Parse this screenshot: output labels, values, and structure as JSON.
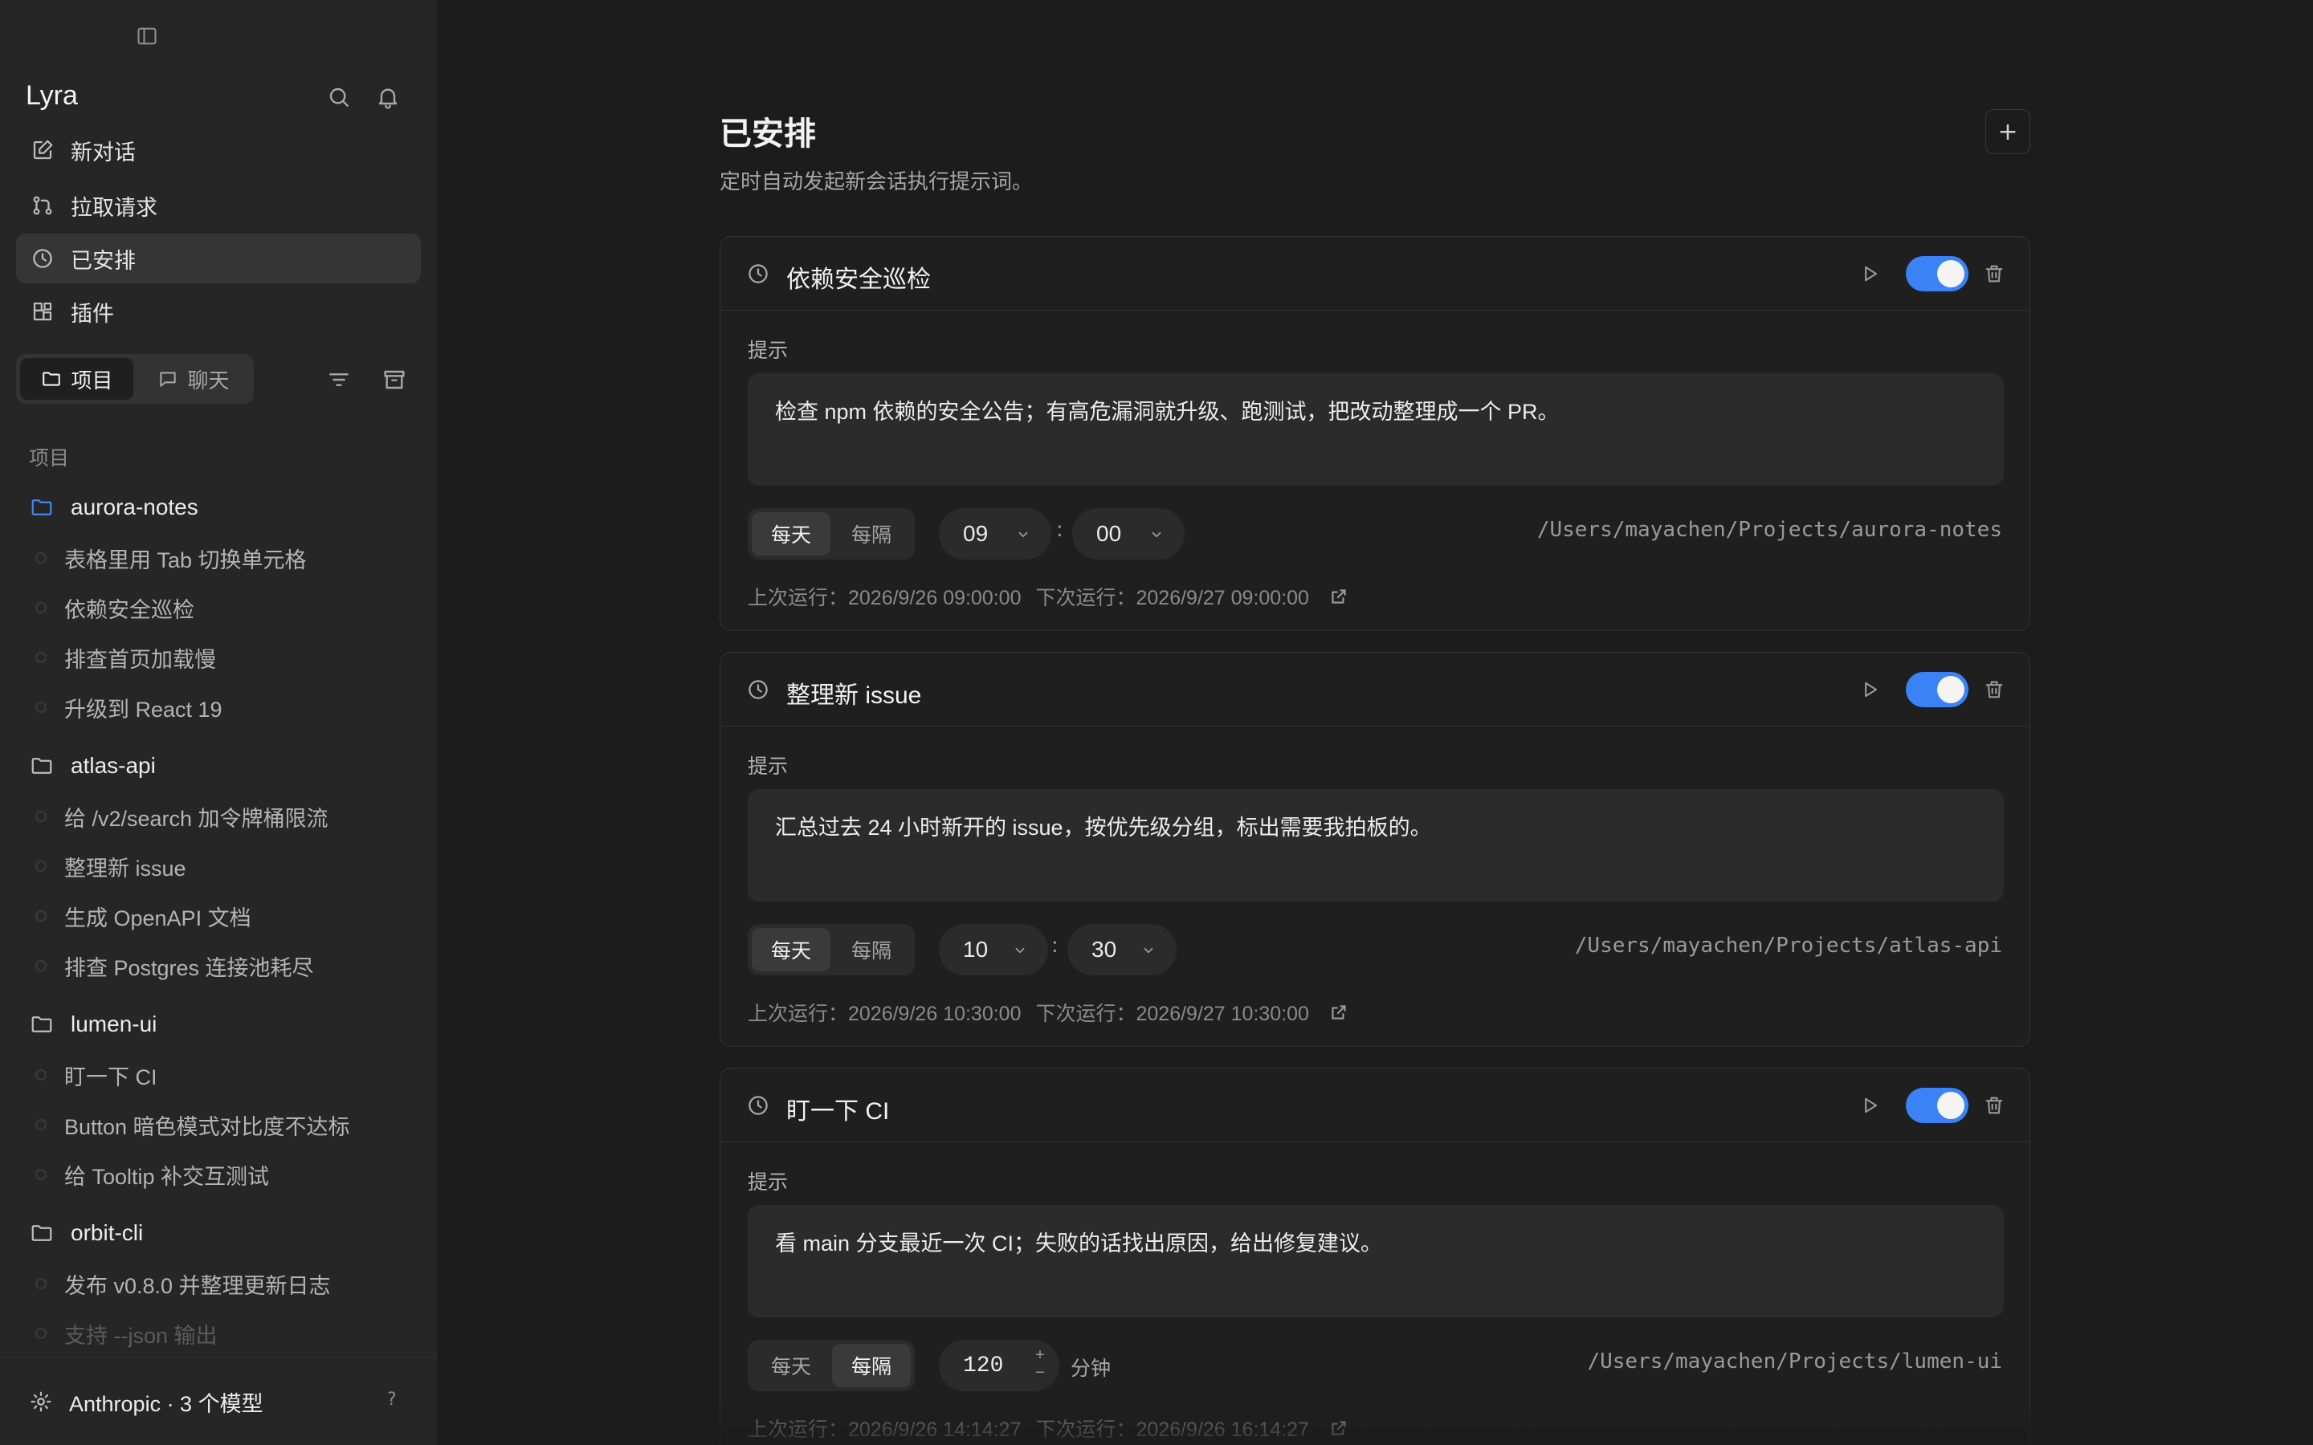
{
  "sidebar": {
    "brand": "Lyra",
    "nav": [
      {
        "label": "新对话",
        "icon": "edit-icon"
      },
      {
        "label": "拉取请求",
        "icon": "pull-request-icon"
      },
      {
        "label": "已安排",
        "icon": "clock-icon"
      },
      {
        "label": "插件",
        "icon": "plugin-icon"
      }
    ],
    "tabs": [
      {
        "label": "项目",
        "icon": "folder-icon"
      },
      {
        "label": "聊天",
        "icon": "chat-icon"
      }
    ],
    "section_label": "项目",
    "projects": [
      {
        "name": "aurora-notes",
        "threads": [
          "表格里用 Tab 切换单元格",
          "依赖安全巡检",
          "排查首页加载慢",
          "升级到 React 19"
        ]
      },
      {
        "name": "atlas-api",
        "threads": [
          "给 /v2/search 加令牌桶限流",
          "整理新 issue",
          "生成 OpenAPI 文档",
          "排查 Postgres 连接池耗尽"
        ]
      },
      {
        "name": "lumen-ui",
        "threads": [
          "盯一下 CI",
          "Button 暗色模式对比度不达标",
          "给 Tooltip 补交互测试"
        ]
      },
      {
        "name": "orbit-cli",
        "threads": [
          "发布 v0.8.0 并整理更新日志",
          "支持 --json 输出"
        ]
      }
    ],
    "footer": {
      "label": "Anthropic · 3 个模型",
      "help": "?"
    }
  },
  "main": {
    "title": "已安排",
    "subtitle": "定时自动发起新会话执行提示词。",
    "add_label": "+",
    "tasks": [
      {
        "title": "依赖安全巡检",
        "enabled": true,
        "prompt_label": "提示",
        "prompt": "检查 npm 依赖的安全公告；有高危漏洞就升级、跑测试，把改动整理成一个 PR。",
        "freq_options": [
          "每天",
          "每隔"
        ],
        "freq_selected": "每天",
        "hour": "09",
        "minute": "00",
        "path": "/Users/mayachen/Projects/aurora-notes",
        "last_run": "上次运行：2026/9/26 09:00:00",
        "next_run": "下次运行：2026/9/27 09:00:00"
      },
      {
        "title": "整理新 issue",
        "enabled": true,
        "prompt_label": "提示",
        "prompt": "汇总过去 24 小时新开的 issue，按优先级分组，标出需要我拍板的。",
        "freq_options": [
          "每天",
          "每隔"
        ],
        "freq_selected": "每天",
        "hour": "10",
        "minute": "30",
        "path": "/Users/mayachen/Projects/atlas-api",
        "last_run": "上次运行：2026/9/26 10:30:00",
        "next_run": "下次运行：2026/9/27 10:30:00"
      },
      {
        "title": "盯一下 CI",
        "enabled": true,
        "prompt_label": "提示",
        "prompt": "看 main 分支最近一次 CI；失败的话找出原因，给出修复建议。",
        "freq_options": [
          "每天",
          "每隔"
        ],
        "freq_selected": "每隔",
        "interval": "120",
        "interval_unit": "分钟",
        "path": "/Users/mayachen/Projects/lumen-ui",
        "last_run": "上次运行：2026/9/26 14:14:27",
        "next_run": "下次运行：2026/9/26 16:14:27"
      }
    ]
  },
  "colors": {
    "accent": "#3b82f6",
    "folder_active": "#3d8bf2",
    "bg": "#1c1c1c",
    "sidebar": "#262626"
  }
}
